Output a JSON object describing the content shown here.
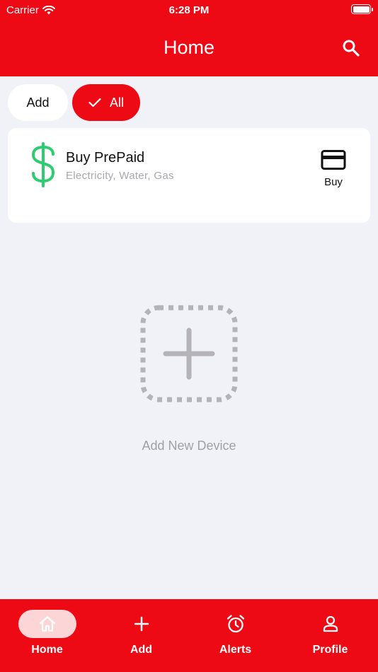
{
  "status_bar": {
    "carrier": "Carrier",
    "time": "6:28 PM"
  },
  "header": {
    "title": "Home"
  },
  "filters": {
    "add_label": "Add",
    "all_label": "All"
  },
  "prepaid_card": {
    "title": "Buy PrePaid",
    "subtitle": "Electricity, Water, Gas",
    "buy_label": "Buy",
    "accent_color": "#2ecc71"
  },
  "add_device": {
    "label": "Add New Device"
  },
  "tabbar": {
    "items": [
      {
        "label": "Home",
        "icon": "home-icon",
        "active": true
      },
      {
        "label": "Add",
        "icon": "plus-icon",
        "active": false
      },
      {
        "label": "Alerts",
        "icon": "alarm-clock-icon",
        "active": false
      },
      {
        "label": "Profile",
        "icon": "person-icon",
        "active": false
      }
    ]
  },
  "colors": {
    "brand": "#ee0a14",
    "background": "#f1f1f8"
  }
}
